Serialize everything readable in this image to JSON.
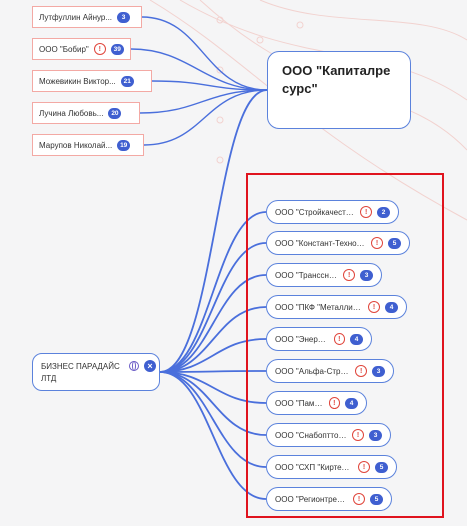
{
  "left_nodes": [
    {
      "name": "Лутфуллин Айнур...",
      "count": "3",
      "warning": false
    },
    {
      "name": "ООО \"Бобир\"",
      "count": "39",
      "warning": true
    },
    {
      "name": "Можевикин Виктор...",
      "count": "21",
      "warning": false
    },
    {
      "name": "Лучина Любовь...",
      "count": "20",
      "warning": false
    },
    {
      "name": "Марупов Николай...",
      "count": "19",
      "warning": false
    }
  ],
  "company_node": {
    "name": "ООО \"Капиталресурс\""
  },
  "root_node": {
    "name": "БИЗНЕС ПАРАДАЙС ЛТД",
    "globe_icon": "globe-icon",
    "close_icon": "close-icon"
  },
  "child_nodes": [
    {
      "name": "ООО \"Стройкачество\"",
      "warning": true,
      "count": "2"
    },
    {
      "name": "ООО \"Констант-Технол...",
      "warning": true,
      "count": "5"
    },
    {
      "name": "ООО \"Трансснаб\"",
      "warning": true,
      "count": "3"
    },
    {
      "name": "ООО \"ПКФ \"Металлист\"",
      "warning": true,
      "count": "4"
    },
    {
      "name": "ООО \"Энергия\"",
      "warning": true,
      "count": "4"
    },
    {
      "name": "ООО \"Альфа-Строй\"",
      "warning": true,
      "count": "3"
    },
    {
      "name": "ООО \"Памир\"",
      "warning": true,
      "count": "4"
    },
    {
      "name": "ООО \"Снабоптторг\"",
      "warning": true,
      "count": "3"
    },
    {
      "name": "ООО \"СХП \"Киртели\"",
      "warning": true,
      "count": "5"
    },
    {
      "name": "ООО \"Регионтрейд\"",
      "warning": true,
      "count": "5"
    }
  ],
  "warning_symbol": "!",
  "close_symbol": "×",
  "colors": {
    "accent": "#3f5fd0",
    "link": "#4a6fdc",
    "warning": "#e0463c",
    "selection": "#e0141e",
    "left_border": "#f3a9a4"
  }
}
